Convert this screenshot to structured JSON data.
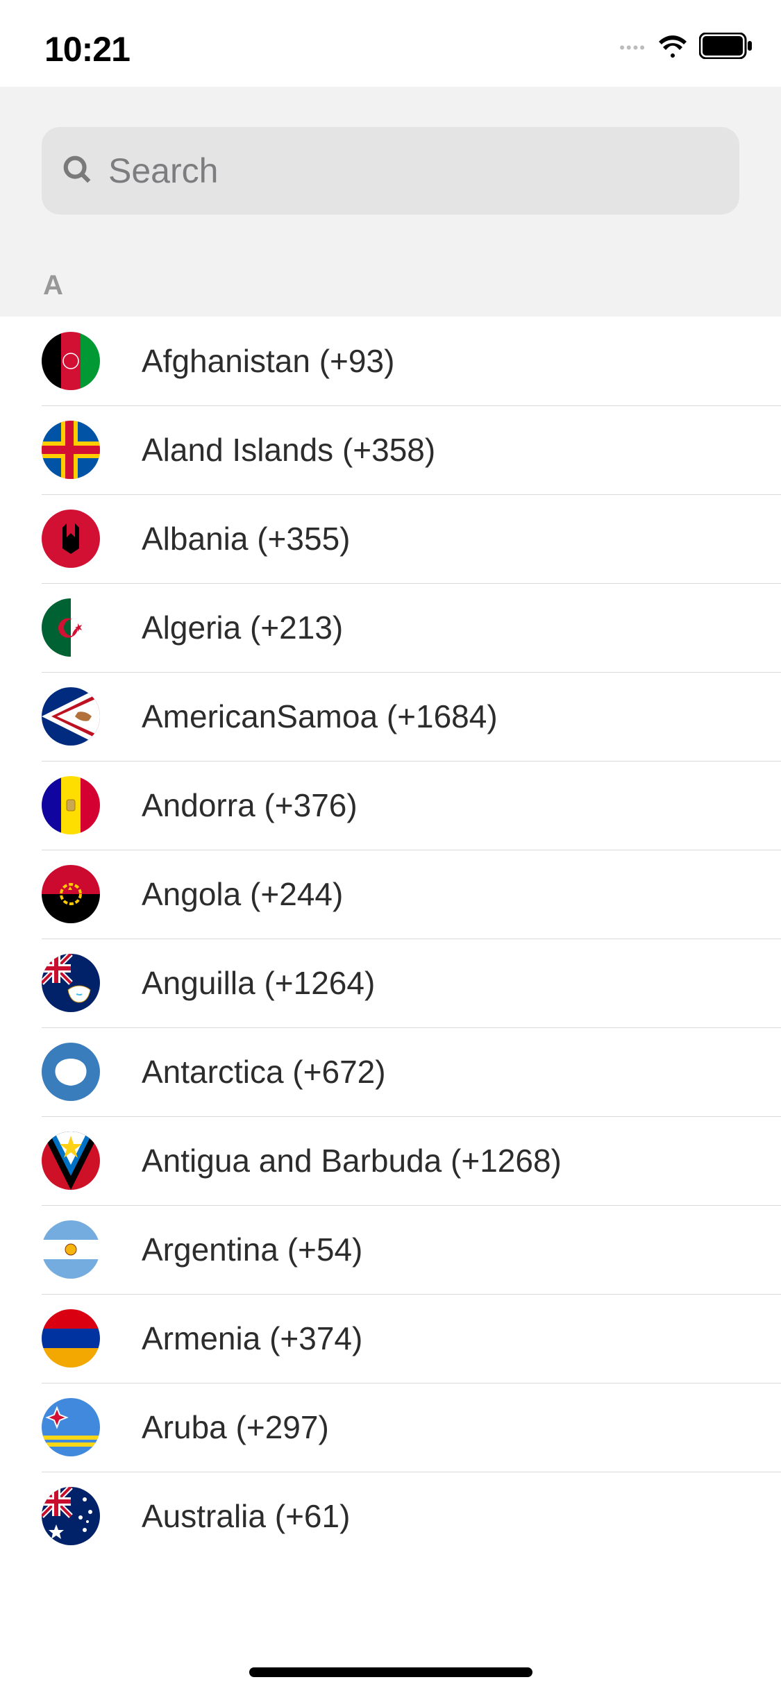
{
  "status": {
    "time": "10:21"
  },
  "search": {
    "placeholder": "Search"
  },
  "section": {
    "title": "A"
  },
  "countries": [
    {
      "name": "Afghanistan",
      "code": "+93"
    },
    {
      "name": "Aland Islands",
      "code": "+358"
    },
    {
      "name": "Albania",
      "code": "+355"
    },
    {
      "name": "Algeria",
      "code": "+213"
    },
    {
      "name": "AmericanSamoa",
      "code": "+1684"
    },
    {
      "name": "Andorra",
      "code": "+376"
    },
    {
      "name": "Angola",
      "code": "+244"
    },
    {
      "name": "Anguilla",
      "code": "+1264"
    },
    {
      "name": "Antarctica",
      "code": "+672"
    },
    {
      "name": "Antigua and Barbuda",
      "code": "+1268"
    },
    {
      "name": "Argentina",
      "code": "+54"
    },
    {
      "name": "Armenia",
      "code": "+374"
    },
    {
      "name": "Aruba",
      "code": "+297"
    },
    {
      "name": "Australia",
      "code": "+61"
    }
  ]
}
